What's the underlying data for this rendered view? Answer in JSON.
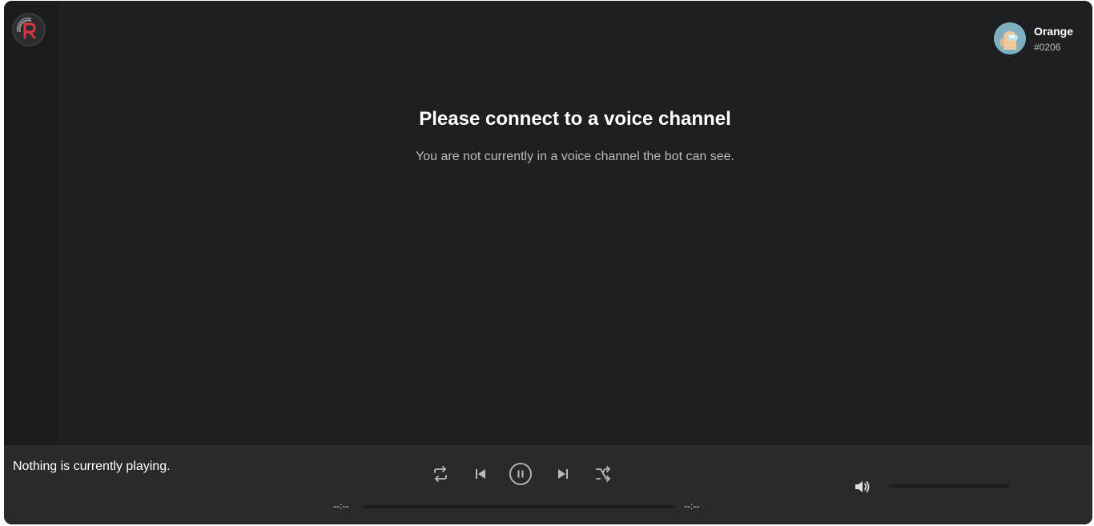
{
  "sidebar": {
    "logo": {
      "icon": "rythm-logo-icon",
      "accent": "#d8343c"
    }
  },
  "user": {
    "name": "Orange",
    "discriminator": "#0206",
    "avatar_icon": "crewmate-avatar-icon",
    "avatar_color": "#7fb0c0"
  },
  "notice": {
    "title": "Please connect to a voice channel",
    "subtitle": "You are not currently in a voice channel the bot can see."
  },
  "player": {
    "now_playing": "Nothing is currently playing.",
    "controls": [
      {
        "name": "repeat-button",
        "icon": "repeat-icon"
      },
      {
        "name": "previous-button",
        "icon": "skip-previous-icon"
      },
      {
        "name": "pause-button",
        "icon": "pause-icon"
      },
      {
        "name": "next-button",
        "icon": "skip-next-icon"
      },
      {
        "name": "shuffle-button",
        "icon": "shuffle-icon"
      }
    ],
    "elapsed": "--:--",
    "duration": "--:--",
    "progress": 0,
    "volume_icon": "volume-icon"
  },
  "colors": {
    "background": "#1e1f22",
    "sidebar": "#1a1b1e",
    "player_bar": "#292a2e",
    "text_primary": "#ffffff",
    "text_secondary": "#b9bbbe"
  }
}
